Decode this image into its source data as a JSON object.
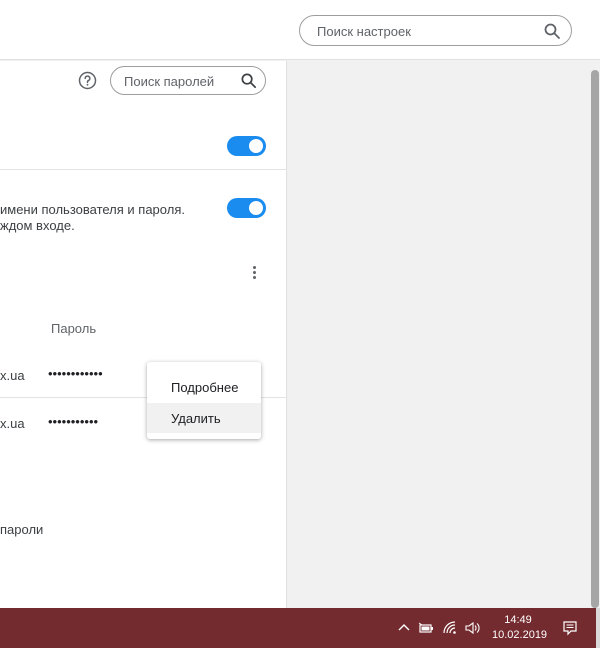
{
  "settings_search": {
    "placeholder": "Поиск настроек"
  },
  "passwords": {
    "search_placeholder": "Поиск паролей",
    "autosignin_desc_line1": "имени пользователя и пароля.",
    "autosignin_desc_line2": "ждом входе.",
    "column_password": "Пароль",
    "rows": [
      {
        "site": "x.ua",
        "password": "••••••••••••"
      },
      {
        "site": "x.ua",
        "password": "•••••••••••"
      }
    ],
    "never_saved_label": "пароли"
  },
  "context_menu": {
    "items": [
      {
        "label": "Подробнее"
      },
      {
        "label": "Удалить"
      }
    ]
  },
  "taskbar": {
    "time": "14:49",
    "date": "10.02.2019"
  },
  "colors": {
    "toggle_on": "#1a8cf0",
    "taskbar": "#732b2f"
  }
}
